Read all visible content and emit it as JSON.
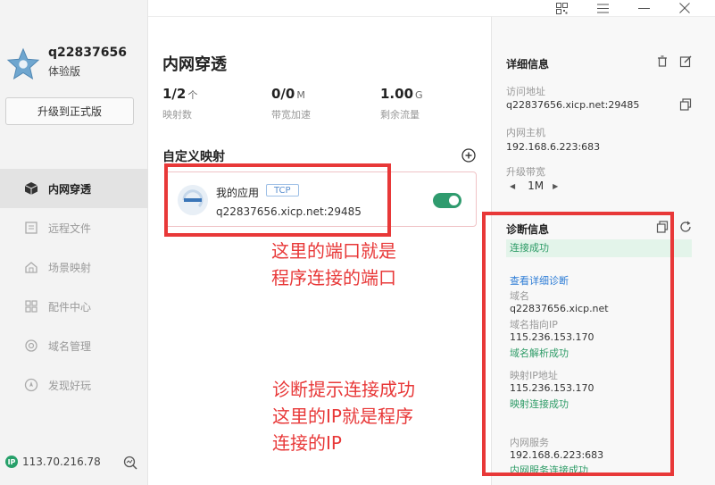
{
  "user": {
    "name": "q22837656",
    "edition": "体验版",
    "upgrade_label": "升级到正式版"
  },
  "nav": [
    {
      "label": "内网穿透",
      "icon": "cube-icon",
      "active": true
    },
    {
      "label": "远程文件",
      "icon": "file-icon",
      "active": false
    },
    {
      "label": "场景映射",
      "icon": "scene-icon",
      "active": false
    },
    {
      "label": "配件中心",
      "icon": "grid-icon",
      "active": false
    },
    {
      "label": "域名管理",
      "icon": "domain-icon",
      "active": false
    },
    {
      "label": "发现好玩",
      "icon": "compass-icon",
      "active": false
    }
  ],
  "footer": {
    "ip_badge": "IP",
    "ip": "113.70.216.78"
  },
  "main": {
    "title": "内网穿透",
    "stats": [
      {
        "value": "1/2",
        "unit": "个",
        "label": "映射数"
      },
      {
        "value": "0/0",
        "unit": "M",
        "label": "带宽加速"
      },
      {
        "value": "1.00",
        "unit": "G",
        "label": "剩余流量"
      }
    ],
    "section_title": "自定义映射",
    "mapping": {
      "name": "我的应用",
      "protocol": "TCP",
      "address": "q22837656.xicp.net:29485",
      "enabled": true
    }
  },
  "annotations": {
    "note1": [
      "这里的端口就是",
      "程序连接的端口"
    ],
    "note2": [
      "诊断提示连接成功",
      "这里的IP就是程序",
      "连接的IP"
    ]
  },
  "detail": {
    "title": "详细信息",
    "access_label": "访问地址",
    "access_value": "q22837656.xicp.net:29485",
    "host_label": "内网主机",
    "host_value": "192.168.6.223:683",
    "bandwidth_label": "升级带宽",
    "bandwidth_value": "1M"
  },
  "diagnosis": {
    "title": "诊断信息",
    "status": "连接成功",
    "detail_link": "查看详细诊断",
    "domain_label": "域名",
    "domain_value": "q22837656.xicp.net",
    "dns_label": "域名指向IP",
    "dns_value": "115.236.153.170",
    "dns_status": "域名解析成功",
    "map_ip_label": "映射IP地址",
    "map_ip_value": "115.236.153.170",
    "map_status": "映射连接成功",
    "lan_label": "内网服务",
    "lan_value": "192.168.6.223:683",
    "lan_status": "内网服务连接成功"
  },
  "colors": {
    "accent_green": "#2d9b66",
    "annotation_red": "#e83838",
    "link_blue": "#2e7dd6"
  }
}
